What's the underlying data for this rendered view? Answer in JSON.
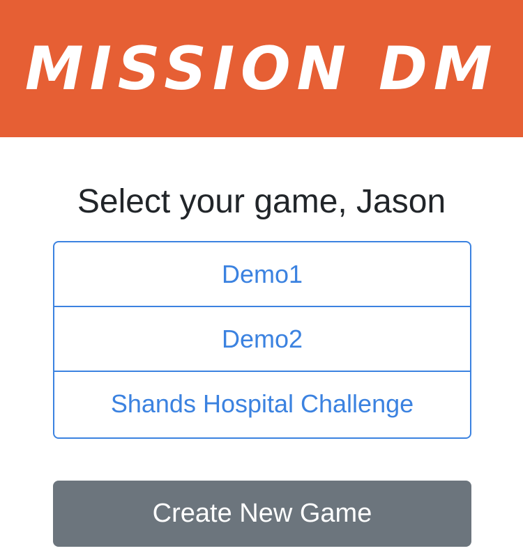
{
  "header": {
    "title": "MISSION DM"
  },
  "main": {
    "heading": "Select your game, Jason",
    "games": [
      {
        "label": "Demo1"
      },
      {
        "label": "Demo2"
      },
      {
        "label": "Shands Hospital Challenge"
      }
    ],
    "create_button_label": "Create New Game"
  },
  "colors": {
    "header_bg": "#e65f34",
    "link": "#3b82e0",
    "button_bg": "#6c757d"
  }
}
